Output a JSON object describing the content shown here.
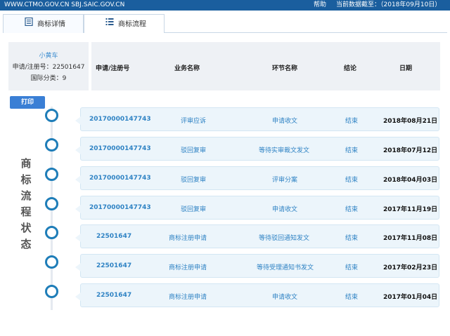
{
  "header": {
    "site": "WWW.CTMO.GOV.CN SBJ.SAIC.GOV.CN",
    "help": "帮助",
    "cutoff": "当前数据截至：（2018年09月10日）"
  },
  "tabs": [
    {
      "label": "商标详情",
      "icon": "document-icon"
    },
    {
      "label": "商标流程",
      "icon": "list-icon"
    }
  ],
  "info": {
    "name": "小黄车",
    "reg_line": "申请/注册号：22501647",
    "class_line": "国际分类：9"
  },
  "columns": {
    "reg": "申请/注册号",
    "biz": "业务名称",
    "step": "环节名称",
    "result": "结论",
    "date": "日期"
  },
  "print_label": "打印",
  "side_title": [
    "商",
    "标",
    "流",
    "程",
    "状",
    "态"
  ],
  "rows": [
    {
      "reg": "20170000147743",
      "biz": "评审应诉",
      "step": "申请收文",
      "result": "结束",
      "date": "2018年08月21日"
    },
    {
      "reg": "20170000147743",
      "biz": "驳回复审",
      "step": "等待实审裁文发文",
      "result": "结束",
      "date": "2018年07月12日"
    },
    {
      "reg": "20170000147743",
      "biz": "驳回复审",
      "step": "评审分案",
      "result": "结束",
      "date": "2018年04月03日"
    },
    {
      "reg": "20170000147743",
      "biz": "驳回复审",
      "step": "申请收文",
      "result": "结束",
      "date": "2017年11月19日"
    },
    {
      "reg": "22501647",
      "biz": "商标注册申请",
      "step": "等待驳回通知发文",
      "result": "结束",
      "date": "2017年11月08日"
    },
    {
      "reg": "22501647",
      "biz": "商标注册申请",
      "step": "等待受理通知书发文",
      "result": "结束",
      "date": "2017年02月23日"
    },
    {
      "reg": "22501647",
      "biz": "商标注册申请",
      "step": "申请收文",
      "result": "结束",
      "date": "2017年01月04日"
    }
  ]
}
